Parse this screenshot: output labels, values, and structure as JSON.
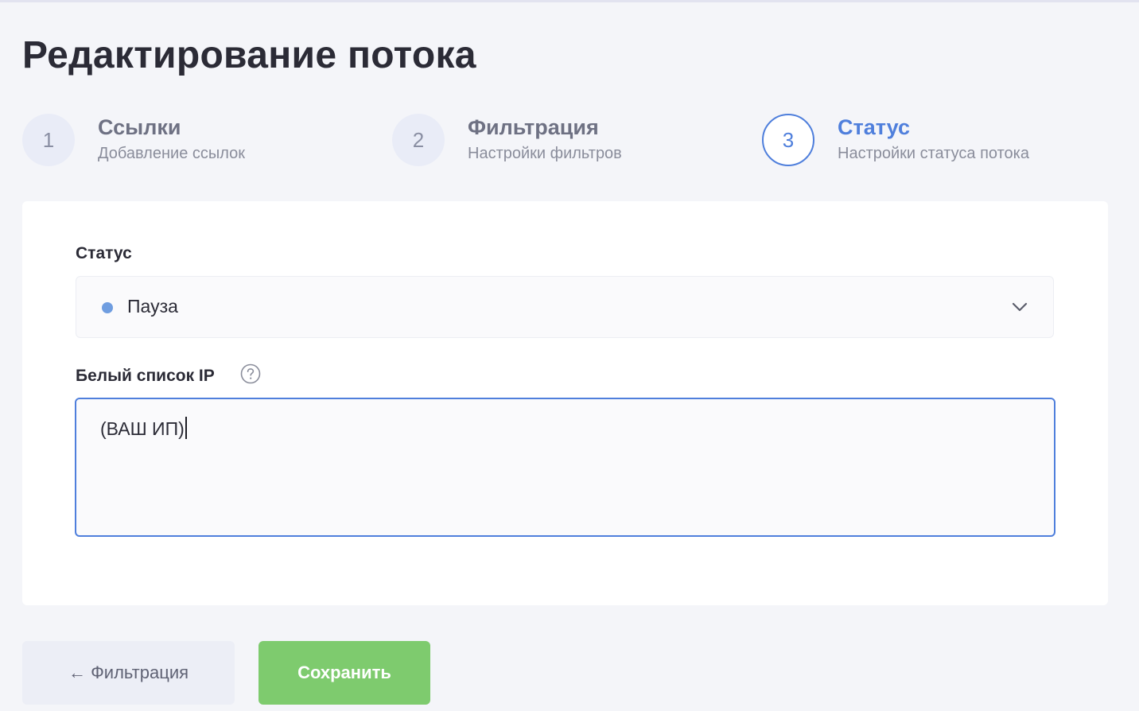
{
  "page": {
    "title": "Редактирование потока"
  },
  "steps": [
    {
      "number": "1",
      "title": "Ссылки",
      "subtitle": "Добавление ссылок",
      "active": false
    },
    {
      "number": "2",
      "title": "Фильтрация",
      "subtitle": "Настройки фильтров",
      "active": false
    },
    {
      "number": "3",
      "title": "Статус",
      "subtitle": "Настройки статуса потока",
      "active": true
    }
  ],
  "status_field": {
    "label": "Статус",
    "selected": "Пауза",
    "dot_color": "#6f9de0",
    "icon": "chevron-down-icon"
  },
  "whitelist_field": {
    "label": "Белый список IP",
    "help_icon": "question-circle-icon",
    "value": "(ВАШ ИП)"
  },
  "buttons": {
    "back_label": "← Фильтрация",
    "save_label": "Сохранить"
  },
  "colors": {
    "accent": "#4f7fdc",
    "save": "#7ecb6e",
    "background": "#f4f5f9"
  }
}
